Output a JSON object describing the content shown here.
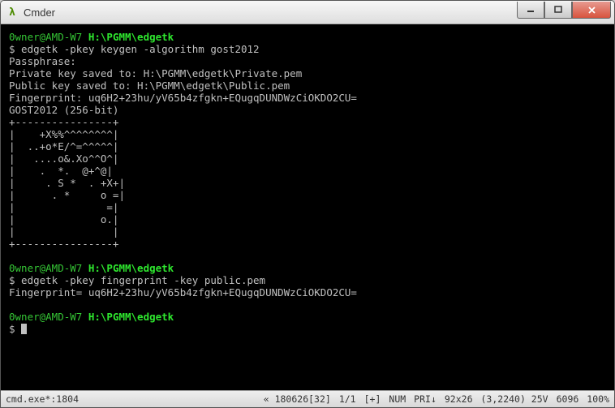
{
  "window": {
    "icon_glyph": "λ",
    "title": "Cmder"
  },
  "session": {
    "p1_user": "0wner@AMD-W7 ",
    "p1_path": "H:\\PGMM\\edgetk",
    "cmd1": "$ edgetk -pkey keygen -algorithm gost2012",
    "out1a": "Passphrase:",
    "out1b": "Private key saved to: H:\\PGMM\\edgetk\\Private.pem",
    "out1c": "Public key saved to: H:\\PGMM\\edgetk\\Public.pem",
    "out1d": "Fingerprint: uq6H2+23hu/yV65b4zfgkn+EQugqDUNDWzCiOKDO2CU=",
    "out1e": "GOST2012 (256-bit)",
    "art01": "+----------------+",
    "art02": "|    +X%%^^^^^^^^|",
    "art03": "|  ..+o*E/^=^^^^^|",
    "art04": "|   ....o&.Xo^^O^|",
    "art05": "|    .  *.  @+^@|",
    "art06": "|     . S *  . +X+|",
    "art07": "|      . *     o =|",
    "art08": "|               =|",
    "art09": "|              o.|",
    "art10": "|                |",
    "art11": "+----------------+",
    "p2_user": "0wner@AMD-W7 ",
    "p2_path": "H:\\PGMM\\edgetk",
    "cmd2": "$ edgetk -pkey fingerprint -key public.pem",
    "out2a": "Fingerprint= uq6H2+23hu/yV65b4zfgkn+EQugqDUNDWzCiOKDO2CU=",
    "p3_user": "0wner@AMD-W7 ",
    "p3_path": "H:\\PGMM\\edgetk",
    "cmd3": "$ "
  },
  "statusbar": {
    "left": "cmd.exe*:1804",
    "r1": "« 180626[32]",
    "r2": "1/1",
    "r3": "[+]",
    "r4": "NUM",
    "r5": "PRI↓",
    "r6": "92x26",
    "r7": "(3,2240) 25V",
    "r8": "6096",
    "r9": "100%"
  }
}
